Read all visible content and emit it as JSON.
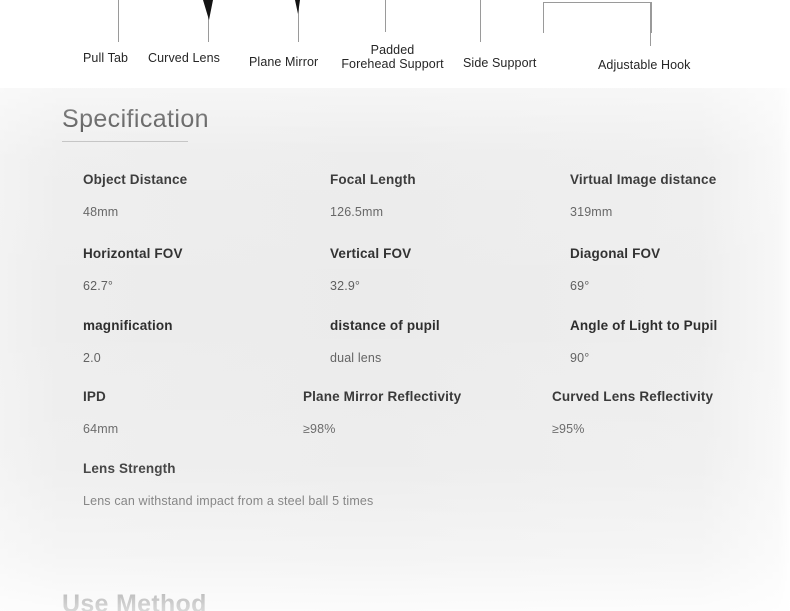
{
  "diagram": {
    "callouts": [
      {
        "name": "callout-pull-tab",
        "label": "Pull Tab"
      },
      {
        "name": "callout-curved-lens",
        "label": "Curved Lens"
      },
      {
        "name": "callout-plane-mirror",
        "label": "Plane Mirror"
      },
      {
        "name": "callout-padded-forehead-support",
        "label_line1": "Padded",
        "label_line2": "Forehead Support"
      },
      {
        "name": "callout-side-support",
        "label": "Side Support"
      },
      {
        "name": "callout-adjustable-hook",
        "label": "Adjustable Hook"
      }
    ]
  },
  "specification": {
    "heading": "Specification",
    "rows": [
      {
        "cells": [
          {
            "label": "Object Distance",
            "value": "48mm"
          },
          {
            "label": "Focal Length",
            "value": "126.5mm"
          },
          {
            "label": "Virtual Image distance",
            "value": "319mm"
          }
        ]
      },
      {
        "cells": [
          {
            "label": "Horizontal FOV",
            "value": "62.7°"
          },
          {
            "label": "Vertical FOV",
            "value": "32.9°"
          },
          {
            "label": "Diagonal FOV",
            "value": "69°"
          }
        ]
      },
      {
        "cells": [
          {
            "label": "magnification",
            "value": "2.0"
          },
          {
            "label": "distance of pupil",
            "value": "dual lens"
          },
          {
            "label": "Angle of Light to Pupil",
            "value": "90°"
          }
        ]
      },
      {
        "cells": [
          {
            "label": "IPD",
            "value": "64mm"
          },
          {
            "label": "Plane Mirror Reflectivity",
            "value": "≥98%"
          },
          {
            "label": "Curved Lens Reflectivity",
            "value": "≥95%"
          }
        ]
      }
    ],
    "lens_strength": {
      "label": "Lens Strength",
      "value": "Lens can withstand impact from a steel ball 5 times"
    }
  },
  "use_method": {
    "heading": "Use Method"
  },
  "colors": {
    "label_text": "#2b2b2b",
    "value_text": "#5d5d5d",
    "heading_text": "#2a2a2a",
    "rule": "#b9b9b9",
    "leader_line": "#9a9a9a",
    "page_background": "#ececec"
  }
}
